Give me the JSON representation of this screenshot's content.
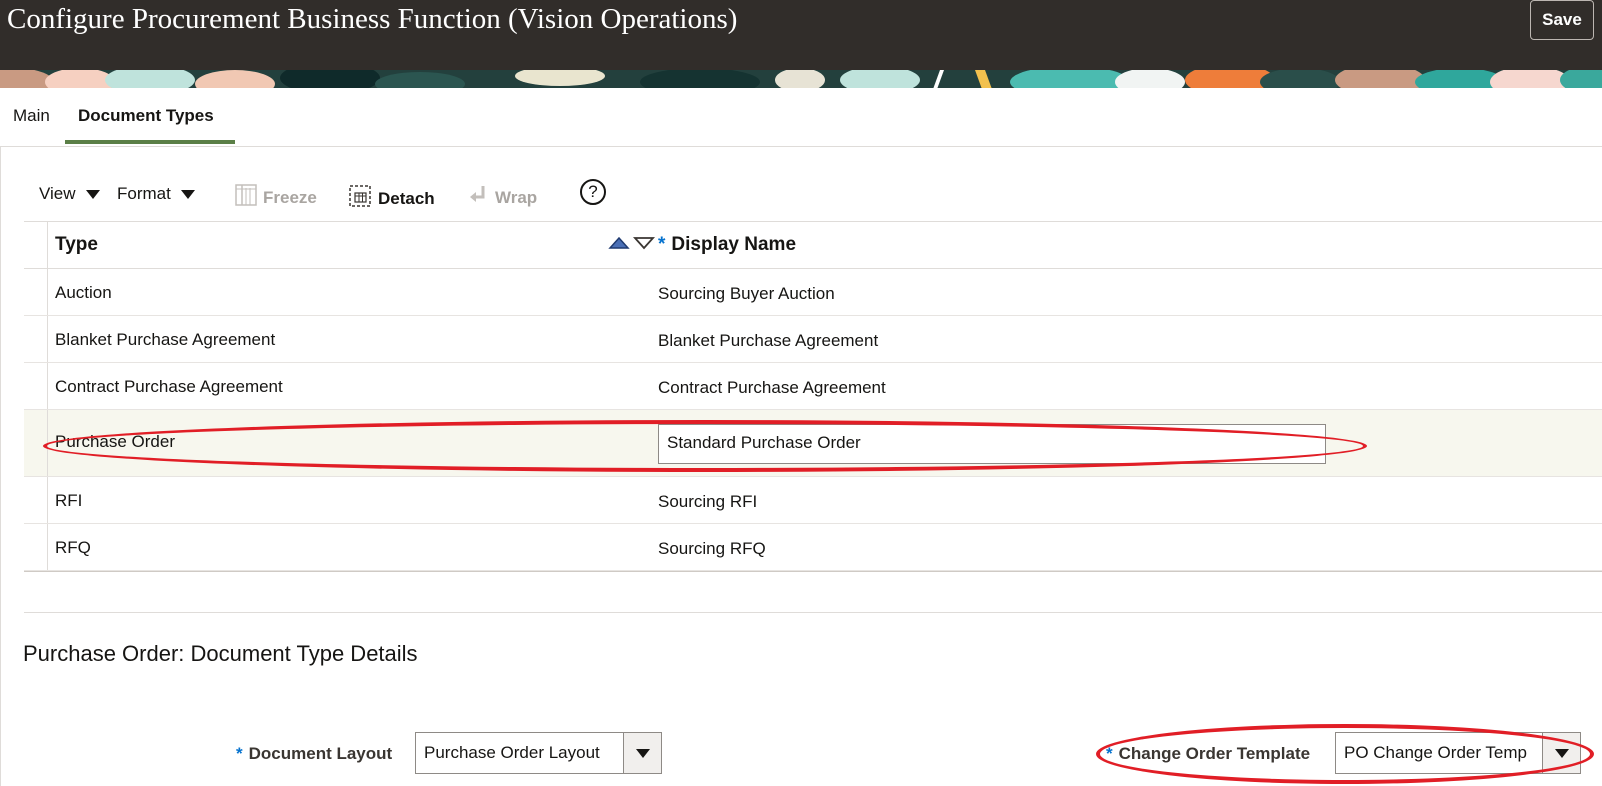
{
  "header": {
    "title": "Configure Procurement Business Function (Vision Operations)",
    "save_label": "Save"
  },
  "tabs": [
    {
      "label": "Main",
      "selected": false
    },
    {
      "label": "Document Types",
      "selected": true
    }
  ],
  "toolbar": {
    "view_label": "View",
    "format_label": "Format",
    "freeze_label": "Freeze",
    "detach_label": "Detach",
    "wrap_label": "Wrap",
    "help_glyph": "?"
  },
  "table": {
    "columns": {
      "type": "Type",
      "display_name": "Display Name",
      "required_marker": "*"
    },
    "rows": [
      {
        "type": "Auction",
        "display_name": "Sourcing Buyer Auction"
      },
      {
        "type": "Blanket Purchase Agreement",
        "display_name": "Blanket Purchase Agreement"
      },
      {
        "type": "Contract Purchase Agreement",
        "display_name": "Contract Purchase Agreement"
      },
      {
        "type": "Purchase Order",
        "display_name": "Standard Purchase Order",
        "selected": true
      },
      {
        "type": "RFI",
        "display_name": "Sourcing RFI"
      },
      {
        "type": "RFQ",
        "display_name": "Sourcing RFQ"
      }
    ]
  },
  "details": {
    "section_title": "Purchase Order: Document Type Details",
    "document_layout": {
      "label": "Document Layout",
      "required_marker": "*",
      "value": "Purchase Order Layout"
    },
    "change_order_template": {
      "label": "Change Order Template",
      "required_marker": "*",
      "value": "PO Change Order Temp"
    }
  },
  "colors": {
    "header_bg": "#312d2a",
    "tab_accent": "#5b7f47",
    "required": "#0572ce",
    "annotation": "#e11e26",
    "selected_row": "#f7f7ee"
  }
}
